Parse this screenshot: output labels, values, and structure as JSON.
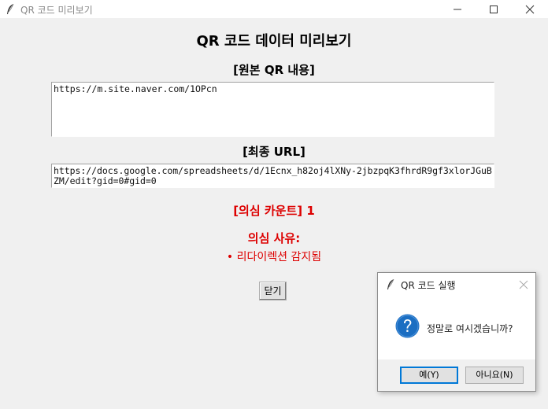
{
  "window": {
    "title": "QR 코드 미리보기"
  },
  "main": {
    "heading": "QR 코드 데이터 미리보기",
    "original_label": "[원본 QR 내용]",
    "original_value": "https://m.site.naver.com/1OPcn",
    "final_label": "[최종 URL]",
    "final_value": "https://docs.google.com/spreadsheets/d/1Ecnx_h82oj4lXNy-2jbzpqK3fhrdR9gf3xlorJGuBZM/edit?gid=0#gid=0",
    "suspect_count_label": "[의심 카운트] 1",
    "suspect_reason_title": "의심 사유:",
    "suspect_reason": "• 리다이렉션 감지됨",
    "close_label": "닫기"
  },
  "dialog": {
    "title": "QR 코드 실행",
    "message": "정말로 여시겠습니까?",
    "yes_label": "예(Y)",
    "no_label": "아니요(N)"
  },
  "colors": {
    "warning": "#dd0000",
    "question_icon": "#1b6ec2",
    "focus_border": "#0078d7"
  },
  "icons": [
    "feather-icon",
    "minimize-icon",
    "maximize-icon",
    "close-icon",
    "question-icon"
  ]
}
